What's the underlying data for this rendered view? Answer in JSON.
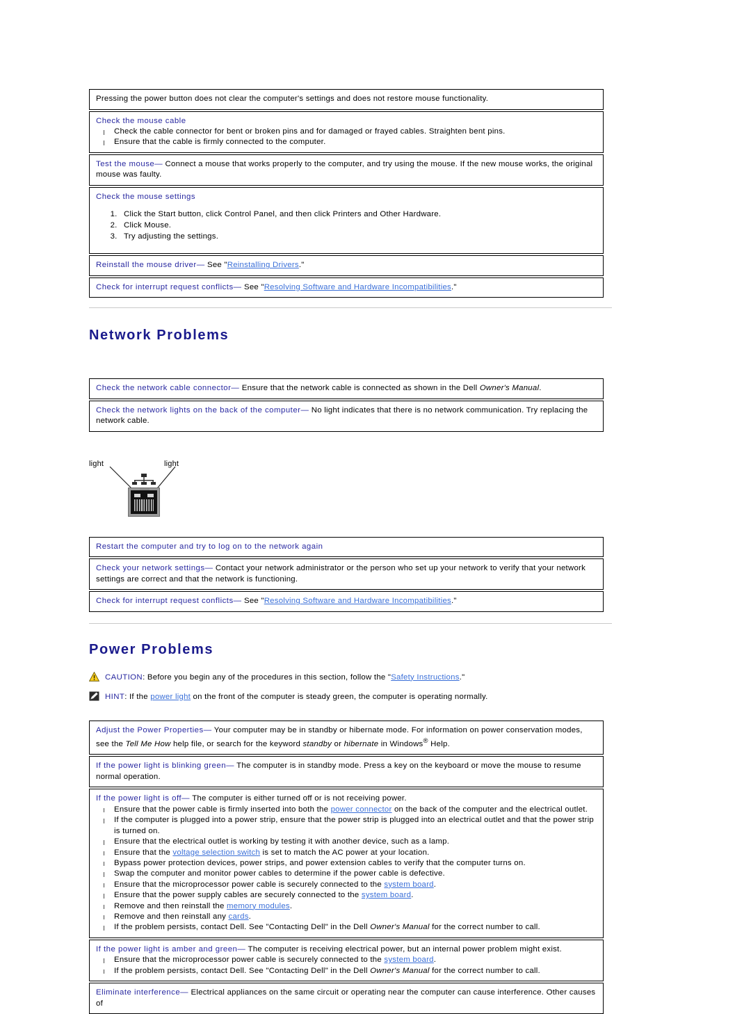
{
  "mouse_section": {
    "intro_row": "Pressing the power button does not clear the computer's settings and does not restore mouse functionality.",
    "check_cable": {
      "label": "Check the mouse cable",
      "bullets": [
        "Check the cable connector for bent or broken pins and for damaged or frayed cables. Straighten bent pins.",
        "Ensure that the cable is firmly connected to the computer."
      ]
    },
    "test_mouse": {
      "label": "Test the mouse",
      "dash": "—",
      "body": " Connect a mouse that works properly to the computer, and try using the mouse. If the new mouse works, the original mouse was faulty."
    },
    "check_settings": {
      "label": "Check the mouse settings",
      "steps": [
        "Click the Start button, click Control Panel, and then click Printers and Other Hardware.",
        "Click Mouse.",
        "Try adjusting the settings."
      ]
    },
    "reinstall_driver": {
      "label": "Reinstall the mouse driver",
      "dash": "—",
      "pre": " See \"",
      "link": "Reinstalling Drivers",
      "post": ".\""
    },
    "interrupt_conflicts": {
      "label": "Check for interrupt request conflicts",
      "dash": "—",
      "pre": " See \"",
      "link": "Resolving Software and Hardware Incompatibilities",
      "post": ".\""
    }
  },
  "network": {
    "title": "Network Problems",
    "cable_connector": {
      "label": "Check the network cable connector",
      "dash": "—",
      "pre": " Ensure that the network cable is connected as shown in the Dell ",
      "italic": "Owner's Manual",
      "post": "."
    },
    "network_lights": {
      "label": "Check the network lights on the back of the computer",
      "dash": "—",
      "body": " No light indicates that there is no network communication. Try replacing the network cable."
    },
    "figure": {
      "label_left": "light",
      "label_right": "light"
    },
    "restart": {
      "label": "Restart the computer and try to log on to the network again"
    },
    "settings": {
      "label": "Check your network settings",
      "dash": "—",
      "body": " Contact your network administrator or the person who set up your network to verify that your network settings are correct and that the network is functioning."
    },
    "interrupt_conflicts": {
      "label": "Check for interrupt request conflicts",
      "dash": "—",
      "pre": " See \"",
      "link": "Resolving Software and Hardware Incompatibilities",
      "post": ".\""
    }
  },
  "power": {
    "title": "Power Problems",
    "caution": {
      "label": "CAUTION",
      "pre": ": Before you begin any of the procedures in this section, follow the \"",
      "link": "Safety Instructions",
      "post": ".\""
    },
    "hint": {
      "label": "HINT",
      "pre": ": If the ",
      "link": "power light",
      "post": " on the front of the computer is steady green, the computer is operating normally."
    },
    "adjust_properties": {
      "label": "Adjust the Power Properties",
      "dash": "—",
      "p1": " Your computer may be in standby or hibernate mode. For information on power conservation modes, see the ",
      "i1": "Tell Me How",
      "p2": " help file, or search for the keyword ",
      "i2": "standby",
      "p3": " or ",
      "i3": "hibernate",
      "p4": " in Windows",
      "reg": "®",
      "p5": " Help."
    },
    "blinking_green": {
      "label": "If the power light is blinking green",
      "dash": "—",
      "body": " The computer is in standby mode. Press a key on the keyboard or move the mouse to resume normal operation."
    },
    "light_off": {
      "label": "If the power light is off",
      "dash": "—",
      "body": " The computer is either turned off or is not receiving power."
    },
    "light_off_bullets": [
      {
        "pre": "Ensure that the power cable is firmly inserted into both the ",
        "link": "power connector",
        "post": " on the back of the computer and the electrical outlet."
      },
      {
        "pre": "If the computer is plugged into a power strip, ensure that the power strip is plugged into an electrical outlet and that the power strip is turned on.",
        "link": "",
        "post": ""
      },
      {
        "pre": "Ensure that the electrical outlet is working by testing it with another device, such as a lamp.",
        "link": "",
        "post": ""
      },
      {
        "pre": "Ensure that the ",
        "link": "voltage selection switch",
        "post": " is set to match the AC power at your location."
      },
      {
        "pre": "Bypass power protection devices, power strips, and power extension cables to verify that the computer turns on.",
        "link": "",
        "post": ""
      },
      {
        "pre": "Swap the computer and monitor power cables to determine if the power cable is defective.",
        "link": "",
        "post": ""
      },
      {
        "pre": "Ensure that the microprocessor power cable is securely connected to the ",
        "link": "system board",
        "post": "."
      },
      {
        "pre": "Ensure that the power supply cables are securely connected to the ",
        "link": "system board",
        "post": "."
      },
      {
        "pre": "Remove and then reinstall the ",
        "link": "memory modules",
        "post": "."
      },
      {
        "pre": "Remove and then reinstall any ",
        "link": "cards",
        "post": "."
      },
      {
        "pre": "If the problem persists, contact Dell. See \"Contacting Dell\" in the Dell ",
        "italic": "Owner's Manual",
        "post": " for the correct number to call."
      }
    ],
    "amber_green": {
      "label": "If the power light is amber and green",
      "dash": "—",
      "body": " The computer is receiving electrical power, but an internal power problem might exist."
    },
    "amber_green_bullets": [
      {
        "pre": "Ensure that the microprocessor power cable is securely connected to the ",
        "link": "system board",
        "post": "."
      },
      {
        "pre": "If the problem persists, contact Dell. See \"Contacting Dell\" in the Dell ",
        "italic": "Owner's Manual",
        "post": " for the correct number to call."
      }
    ],
    "eliminate_interference": {
      "label": "Eliminate interference",
      "dash": "—",
      "body": " Electrical appliances on the same circuit or operating near the computer can cause interference. Other causes of"
    }
  },
  "colors": {
    "heading": "#1a1a8c",
    "label": "#2828a0",
    "link": "#3a6fd8",
    "rule": "#c9c9c9",
    "caution_triangle": "#ffd21e"
  }
}
